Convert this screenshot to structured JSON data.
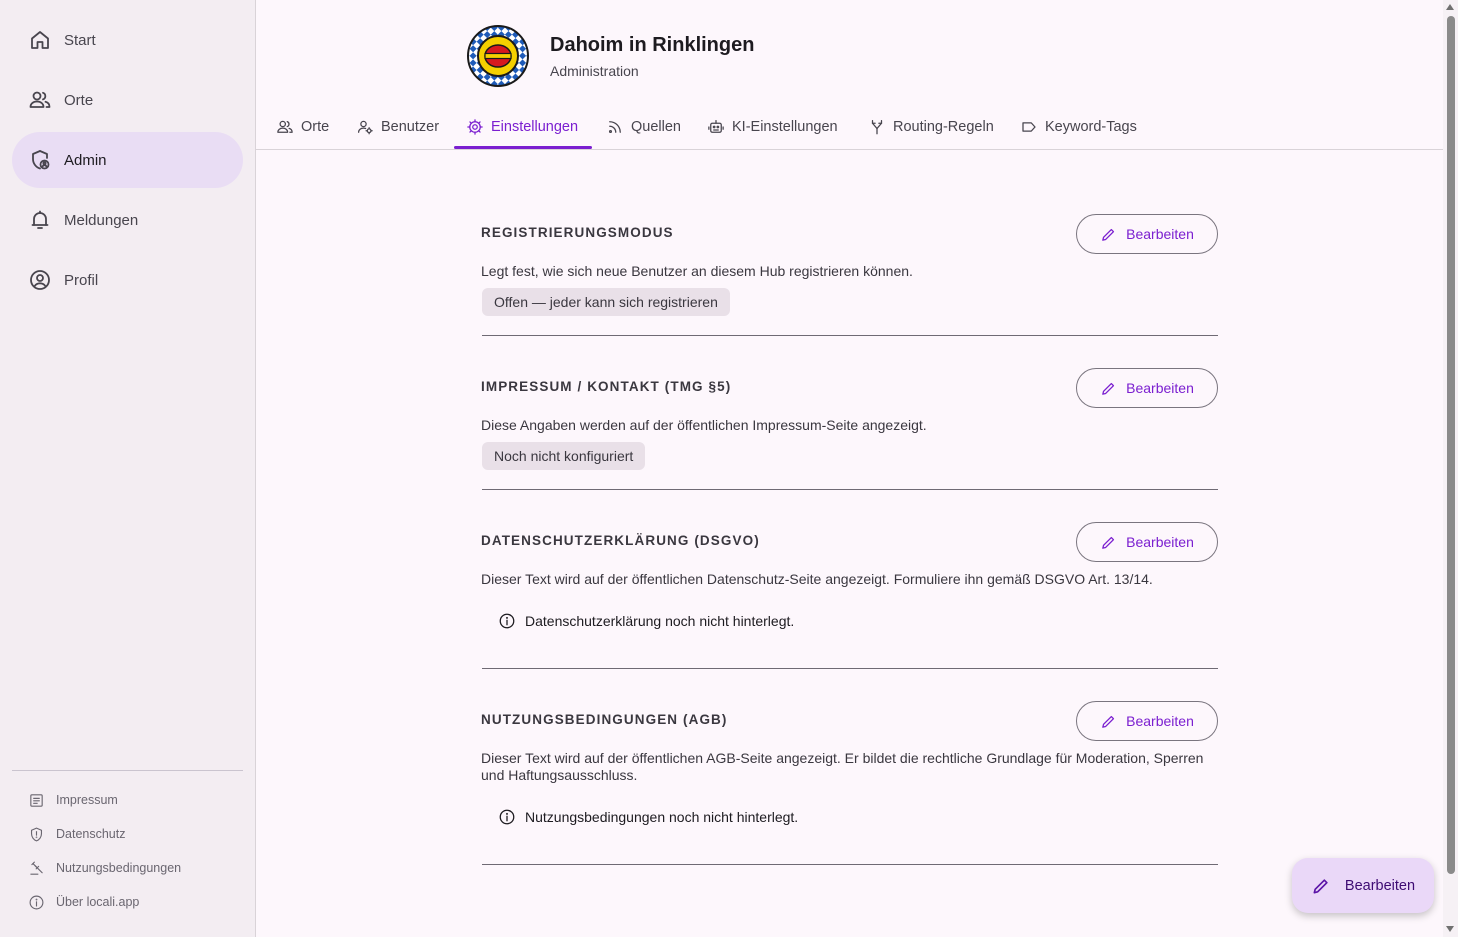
{
  "sidebar": {
    "items": [
      {
        "label": "Start",
        "icon": "home-icon"
      },
      {
        "label": "Orte",
        "icon": "people-icon"
      },
      {
        "label": "Admin",
        "icon": "admin-shield-icon",
        "active": true
      },
      {
        "label": "Meldungen",
        "icon": "bell-icon"
      },
      {
        "label": "Profil",
        "icon": "account-circle-icon"
      }
    ],
    "footer": [
      {
        "label": "Impressum",
        "icon": "article-icon"
      },
      {
        "label": "Datenschutz",
        "icon": "shield-icon"
      },
      {
        "label": "Nutzungsbedingungen",
        "icon": "gavel-icon"
      },
      {
        "label": "Über locali.app",
        "icon": "info-icon"
      }
    ]
  },
  "header": {
    "title": "Dahoim in Rinklingen",
    "subtitle": "Administration"
  },
  "tabs": [
    {
      "label": "Orte",
      "icon": "people-icon"
    },
    {
      "label": "Benutzer",
      "icon": "user-manage-icon"
    },
    {
      "label": "Einstellungen",
      "icon": "gear-icon",
      "active": true
    },
    {
      "label": "Quellen",
      "icon": "rss-icon"
    },
    {
      "label": "KI-Einstellungen",
      "icon": "robot-icon"
    },
    {
      "label": "Routing-Regeln",
      "icon": "fork-icon"
    },
    {
      "label": "Keyword-Tags",
      "icon": "tag-icon"
    }
  ],
  "sections": [
    {
      "title": "REGISTRIERUNGSMODUS",
      "description": "Legt fest, wie sich neue Benutzer an diesem Hub registrieren können.",
      "chip": "Offen — jeder kann sich registrieren",
      "button": "Bearbeiten"
    },
    {
      "title": "IMPRESSUM / KONTAKT (TMG §5)",
      "description": "Diese Angaben werden auf der öffentlichen Impressum-Seite angezeigt.",
      "chip": "Noch nicht konfiguriert",
      "button": "Bearbeiten"
    },
    {
      "title": "DATENSCHUTZERKLÄRUNG (DSGVO)",
      "description": "Dieser Text wird auf der öffentlichen Datenschutz-Seite angezeigt. Formuliere ihn gemäß DSGVO Art. 13/14.",
      "info": "Datenschutzerklärung noch nicht hinterlegt.",
      "button": "Bearbeiten"
    },
    {
      "title": "NUTZUNGSBEDINGUNGEN (AGB)",
      "description": "Dieser Text wird auf der öffentlichen AGB-Seite angezeigt. Er bildet die rechtliche Grundlage für Moderation, Sperren und Haftungsausschluss.",
      "info": "Nutzungsbedingungen noch nicht hinterlegt.",
      "button": "Bearbeiten"
    }
  ],
  "fab": {
    "label": "Bearbeiten",
    "icon": "pencil-icon"
  },
  "colors": {
    "accent": "#7b1fd0",
    "sidebar_bg": "#f3edf2",
    "active_nav": "#e9ddf4",
    "background": "#fdf7fc"
  }
}
